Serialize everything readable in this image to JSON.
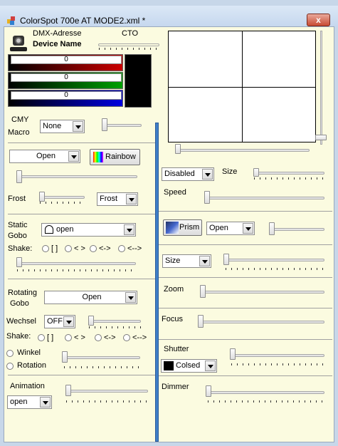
{
  "window": {
    "title": "ColorSpot 700e AT MODE2.xml *",
    "close": "x"
  },
  "device": {
    "dmx_label": "DMX-Adresse",
    "name": "Device Name",
    "cto_label": "CTO"
  },
  "rgb": {
    "red": "0",
    "green": "0",
    "blue": "0"
  },
  "cmy": {
    "label1": "CMY",
    "label2": "Macro",
    "value": "None"
  },
  "color": {
    "wheel_value": "Open",
    "rainbow": "Rainbow",
    "frost_label": "Frost",
    "frost_value": "Frost"
  },
  "static_gobo": {
    "label1": "Static",
    "label2": "Gobo",
    "value": "open",
    "shake_label": "Shake:",
    "shake_opts": [
      "[ ]",
      "< >",
      "<->",
      "<-->"
    ]
  },
  "rotating_gobo": {
    "label1": "Rotating",
    "label2": "Gobo",
    "value": "Open",
    "wechsel_label": "Wechsel",
    "wechsel_value": "OFF",
    "shake_label": "Shake:",
    "shake_opts": [
      "[ ]",
      "< >",
      "<->",
      "<-->"
    ],
    "winkel": "Winkel",
    "rotation": "Rotation"
  },
  "animation": {
    "label": "Animation",
    "value": "open"
  },
  "right": {
    "disabled": "Disabled",
    "size_label": "Size",
    "speed_label": "Speed",
    "prism": "Prism",
    "prism_value": "Open",
    "size_combo": "Size",
    "zoom": "Zoom",
    "focus": "Focus",
    "shutter": "Shutter",
    "shutter_value": "Colsed",
    "dimmer": "Dimmer"
  },
  "colors": {
    "red": "#cc0000",
    "green": "#00a000",
    "blue": "#0000e0",
    "track_bg": "#fbfbe0",
    "divider": "#3f7fc7"
  }
}
